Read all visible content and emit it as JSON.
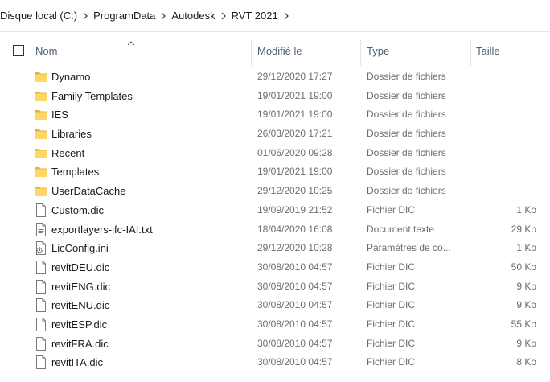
{
  "breadcrumb": [
    "Disque local (C:)",
    "ProgramData",
    "Autodesk",
    "RVT 2021"
  ],
  "columns": {
    "name": "Nom",
    "modified": "Modifié le",
    "type": "Type",
    "size": "Taille"
  },
  "colors": {
    "folder": "#ffd766",
    "folder_dark": "#e6b43c",
    "header_text": "#4c607a",
    "meta_text": "#6d6d6d"
  },
  "rows": [
    {
      "icon": "folder-icon",
      "name": "Dynamo",
      "modified": "29/12/2020 17:27",
      "type": "Dossier de fichiers",
      "size": ""
    },
    {
      "icon": "folder-icon",
      "name": "Family Templates",
      "modified": "19/01/2021 19:00",
      "type": "Dossier de fichiers",
      "size": ""
    },
    {
      "icon": "folder-icon",
      "name": "IES",
      "modified": "19/01/2021 19:00",
      "type": "Dossier de fichiers",
      "size": ""
    },
    {
      "icon": "folder-icon",
      "name": "Libraries",
      "modified": "26/03/2020 17:21",
      "type": "Dossier de fichiers",
      "size": ""
    },
    {
      "icon": "folder-icon",
      "name": "Recent",
      "modified": "01/06/2020 09:28",
      "type": "Dossier de fichiers",
      "size": ""
    },
    {
      "icon": "folder-icon",
      "name": "Templates",
      "modified": "19/01/2021 19:00",
      "type": "Dossier de fichiers",
      "size": ""
    },
    {
      "icon": "folder-icon",
      "name": "UserDataCache",
      "modified": "29/12/2020 10:25",
      "type": "Dossier de fichiers",
      "size": ""
    },
    {
      "icon": "file-icon",
      "name": "Custom.dic",
      "modified": "19/09/2019 21:52",
      "type": "Fichier DIC",
      "size": "1 Ko"
    },
    {
      "icon": "text-file-icon",
      "name": "exportlayers-ifc-IAI.txt",
      "modified": "18/04/2020 16:08",
      "type": "Document texte",
      "size": "29 Ko"
    },
    {
      "icon": "settings-file-icon",
      "name": "LicConfig.ini",
      "modified": "29/12/2020 10:28",
      "type": "Paramètres de co...",
      "size": "1 Ko"
    },
    {
      "icon": "file-icon",
      "name": "revitDEU.dic",
      "modified": "30/08/2010 04:57",
      "type": "Fichier DIC",
      "size": "50 Ko"
    },
    {
      "icon": "file-icon",
      "name": "revitENG.dic",
      "modified": "30/08/2010 04:57",
      "type": "Fichier DIC",
      "size": "9 Ko"
    },
    {
      "icon": "file-icon",
      "name": "revitENU.dic",
      "modified": "30/08/2010 04:57",
      "type": "Fichier DIC",
      "size": "9 Ko"
    },
    {
      "icon": "file-icon",
      "name": "revitESP.dic",
      "modified": "30/08/2010 04:57",
      "type": "Fichier DIC",
      "size": "55 Ko"
    },
    {
      "icon": "file-icon",
      "name": "revitFRA.dic",
      "modified": "30/08/2010 04:57",
      "type": "Fichier DIC",
      "size": "9 Ko"
    },
    {
      "icon": "file-icon",
      "name": "revitITA.dic",
      "modified": "30/08/2010 04:57",
      "type": "Fichier DIC",
      "size": "8 Ko"
    }
  ]
}
